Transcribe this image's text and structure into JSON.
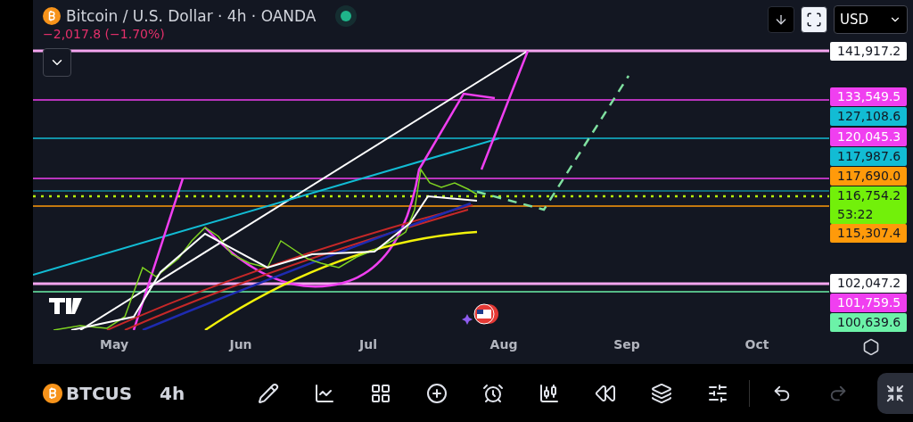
{
  "header": {
    "title": "Bitcoin / U.S. Dollar · 4h · OANDA",
    "market_open": true,
    "change": "−2,017.8 (−1.70%)",
    "currency": "USD"
  },
  "price_labels": [
    {
      "text": "141,917.2",
      "color": "#ffffff"
    },
    {
      "text": "133,549.5",
      "color": "#f03ff0"
    },
    {
      "text": "127,108.6",
      "color": "#12bcd4"
    },
    {
      "text": "120,045.3",
      "color": "#f03ff0"
    },
    {
      "text": "117,987.6",
      "color": "#12bcd4"
    },
    {
      "text": "117,690.0",
      "color": "#ff9a0a"
    },
    {
      "text": "116,754.2",
      "countdown": "53:22",
      "color": "#72f00a"
    },
    {
      "text": "115,307.4",
      "color": "#ff9a0a"
    },
    {
      "text": "102,047.2",
      "color": "#ffffff"
    },
    {
      "text": "101,759.5",
      "color": "#f03ff0"
    },
    {
      "text": "100,639.6",
      "color": "#6cf2a8"
    }
  ],
  "time_axis": [
    "May",
    "Jun",
    "Jul",
    "Aug",
    "Sep",
    "Oct"
  ],
  "toolbar": {
    "symbol": "BTCUS",
    "interval": "4h",
    "redo_disabled": true
  }
}
